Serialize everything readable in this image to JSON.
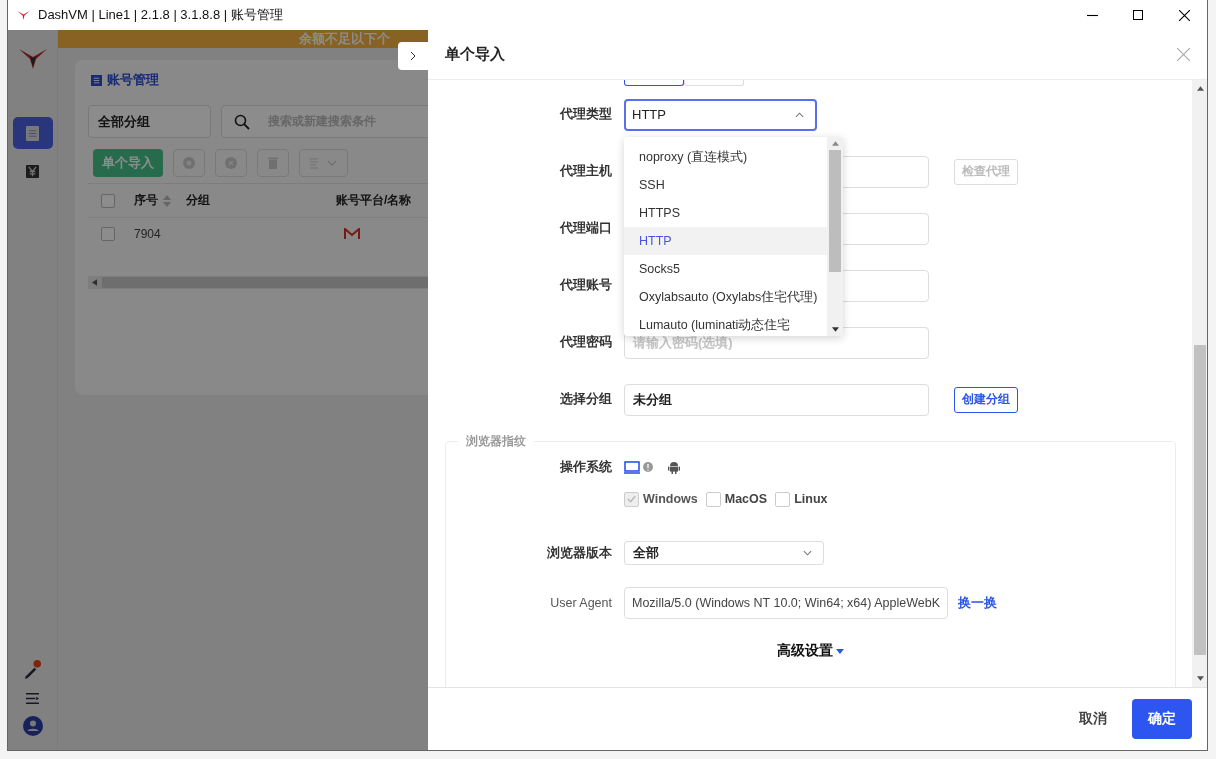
{
  "window": {
    "title": "DashVM | Line1 | 2.1.8 | 3.1.8.8 | 账号管理"
  },
  "sidebar": {
    "items": [
      {
        "kind": "list",
        "selected": true
      },
      {
        "kind": "yen",
        "selected": false
      }
    ],
    "bottom": [
      {
        "kind": "pen",
        "notice": true
      },
      {
        "kind": "menu",
        "notice": false
      },
      {
        "kind": "user",
        "notice": false
      }
    ]
  },
  "banner": {
    "text": "余额不足以下个"
  },
  "page": {
    "tab": "账号管理",
    "group_filter": "全部分组",
    "search": {
      "placeholder": "搜索或新建搜索条件"
    },
    "import_button": "单个导入",
    "table": {
      "select_all_checked": false,
      "columns": [
        "序号",
        "分组",
        "账号平台/名称"
      ],
      "rows": [
        {
          "number": "7904",
          "checked": false,
          "kind": "mail"
        }
      ]
    }
  },
  "drawer": {
    "title": "单个导入",
    "fields": [
      {
        "kind": "select",
        "label": "代理类型",
        "value": "HTTP",
        "open": true
      },
      {
        "kind": "input",
        "label": "代理主机",
        "action": {
          "label": "检查代理",
          "disabled": true
        }
      },
      {
        "kind": "input",
        "label": "代理端口"
      },
      {
        "kind": "input",
        "label": "代理账号"
      },
      {
        "kind": "input",
        "label": "代理密码",
        "placeholder": "请输入密码(选填)"
      },
      {
        "kind": "input",
        "label": "选择分组",
        "value": "未分组",
        "action": {
          "label": "创建分组",
          "disabled": false
        }
      }
    ],
    "proxy_options": [
      {
        "label": "noproxy (直连模式)",
        "selected": false
      },
      {
        "label": "SSH",
        "selected": false
      },
      {
        "label": "HTTPS",
        "selected": false
      },
      {
        "label": "HTTP",
        "selected": true
      },
      {
        "label": "Socks5",
        "selected": false
      },
      {
        "label": "Oxylabsauto (Oxylabs住宅代理)",
        "selected": false
      },
      {
        "label": "Lumauto (luminati动态住宅",
        "selected": false
      }
    ],
    "fingerprint": {
      "legend": "浏览器指纹",
      "os_label": "操作系统",
      "os_types": [
        {
          "kind": "desktop",
          "selected": true
        },
        {
          "kind": "android",
          "selected": false
        }
      ],
      "os_options": [
        {
          "label": "Windows",
          "checked": true,
          "disabled": true
        },
        {
          "label": "MacOS",
          "checked": false,
          "disabled": false
        },
        {
          "label": "Linux",
          "checked": false,
          "disabled": false
        }
      ],
      "browser_version": {
        "label": "浏览器版本",
        "value": "全部"
      },
      "user_agent": {
        "label": "User Agent",
        "value": "Mozilla/5.0 (Windows NT 10.0; Win64; x64) AppleWebK",
        "action": "换一换"
      },
      "advanced": "高级设置"
    },
    "footer": {
      "cancel": "取消",
      "confirm": "确定"
    }
  }
}
